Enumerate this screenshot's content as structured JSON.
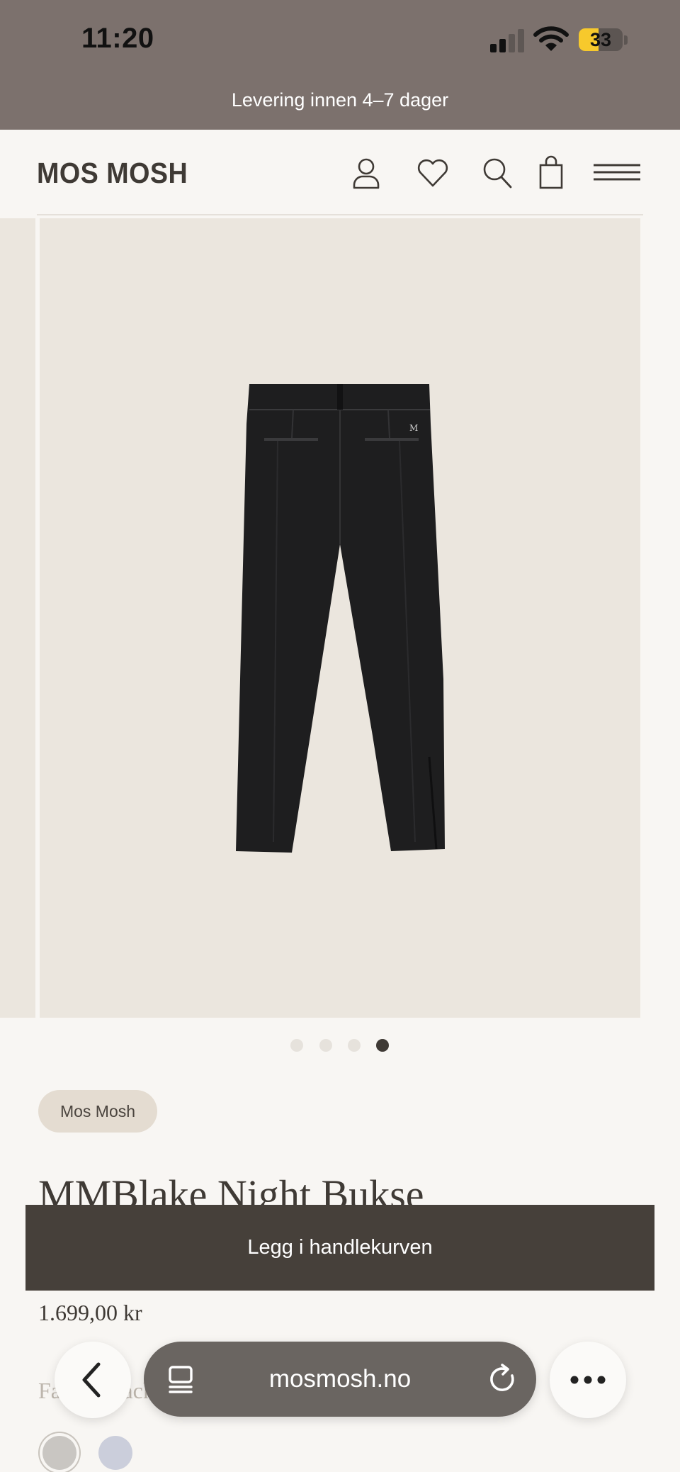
{
  "status_bar": {
    "time": "11:20",
    "battery": "33"
  },
  "announcement": "Levering innen 4–7 dager",
  "header": {
    "logo": "MOS MOSH",
    "icons": [
      "account-icon",
      "wishlist-heart-icon",
      "search-icon",
      "shopping-bag-icon",
      "menu-icon"
    ]
  },
  "gallery": {
    "image": "black-trousers-back-view",
    "dot_count": 4,
    "active_dot": 4
  },
  "product": {
    "brand": "Mos Mosh",
    "title": "MMBlake Night Bukse",
    "add_to_cart": "Legg i handlekurven",
    "price": "1.699,00 kr",
    "color_label": "Farge: Black",
    "swatches": [
      "#c9c6c2",
      "#cbcedb"
    ]
  },
  "browser": {
    "url": "mosmosh.no",
    "icons": [
      "back-icon",
      "tabs-icon",
      "reload-icon",
      "more-icon"
    ]
  }
}
